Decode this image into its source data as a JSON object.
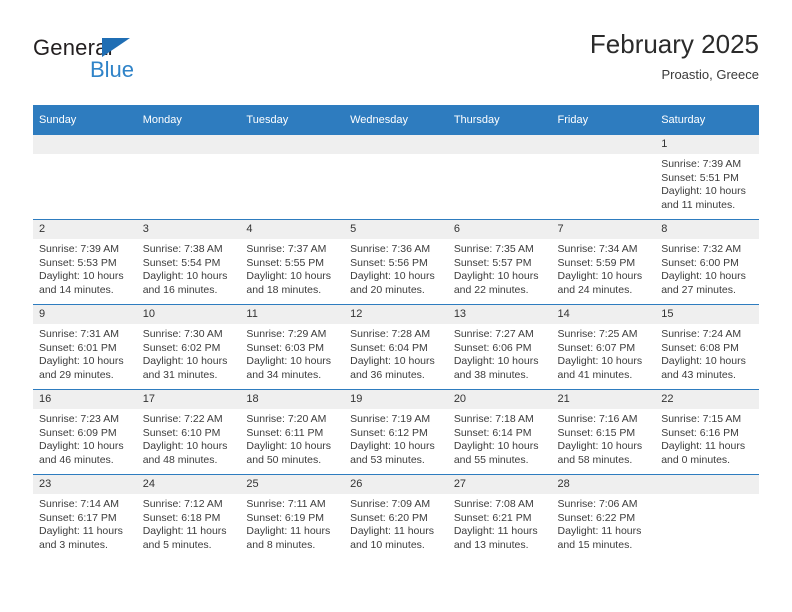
{
  "brand": {
    "name_part1": "General",
    "name_part2": "Blue",
    "triangle_color": "#1f6eb4",
    "text_color": "#231f20",
    "blue_text_color": "#2f83c8"
  },
  "header": {
    "title": "February 2025",
    "subtitle": "Proastio, Greece"
  },
  "theme": {
    "header_blue": "#2e7cbf",
    "daynum_gray": "#efefef",
    "body_text": "#3c3c3c"
  },
  "weekdays": [
    "Sunday",
    "Monday",
    "Tuesday",
    "Wednesday",
    "Thursday",
    "Friday",
    "Saturday"
  ],
  "labels": {
    "sunrise_prefix": "Sunrise:",
    "sunset_prefix": "Sunset:",
    "daylight_prefix": "Daylight:"
  },
  "weeks": [
    [
      {
        "day": "",
        "sunrise": "",
        "sunset": "",
        "daylight_line1": "",
        "daylight_line2": "",
        "empty": true
      },
      {
        "day": "",
        "sunrise": "",
        "sunset": "",
        "daylight_line1": "",
        "daylight_line2": "",
        "empty": true
      },
      {
        "day": "",
        "sunrise": "",
        "sunset": "",
        "daylight_line1": "",
        "daylight_line2": "",
        "empty": true
      },
      {
        "day": "",
        "sunrise": "",
        "sunset": "",
        "daylight_line1": "",
        "daylight_line2": "",
        "empty": true
      },
      {
        "day": "",
        "sunrise": "",
        "sunset": "",
        "daylight_line1": "",
        "daylight_line2": "",
        "empty": true
      },
      {
        "day": "",
        "sunrise": "",
        "sunset": "",
        "daylight_line1": "",
        "daylight_line2": "",
        "empty": true
      },
      {
        "day": "1",
        "sunrise": "Sunrise: 7:39 AM",
        "sunset": "Sunset: 5:51 PM",
        "daylight_line1": "Daylight: 10 hours",
        "daylight_line2": "and 11 minutes.",
        "empty": false
      }
    ],
    [
      {
        "day": "2",
        "sunrise": "Sunrise: 7:39 AM",
        "sunset": "Sunset: 5:53 PM",
        "daylight_line1": "Daylight: 10 hours",
        "daylight_line2": "and 14 minutes.",
        "empty": false
      },
      {
        "day": "3",
        "sunrise": "Sunrise: 7:38 AM",
        "sunset": "Sunset: 5:54 PM",
        "daylight_line1": "Daylight: 10 hours",
        "daylight_line2": "and 16 minutes.",
        "empty": false
      },
      {
        "day": "4",
        "sunrise": "Sunrise: 7:37 AM",
        "sunset": "Sunset: 5:55 PM",
        "daylight_line1": "Daylight: 10 hours",
        "daylight_line2": "and 18 minutes.",
        "empty": false
      },
      {
        "day": "5",
        "sunrise": "Sunrise: 7:36 AM",
        "sunset": "Sunset: 5:56 PM",
        "daylight_line1": "Daylight: 10 hours",
        "daylight_line2": "and 20 minutes.",
        "empty": false
      },
      {
        "day": "6",
        "sunrise": "Sunrise: 7:35 AM",
        "sunset": "Sunset: 5:57 PM",
        "daylight_line1": "Daylight: 10 hours",
        "daylight_line2": "and 22 minutes.",
        "empty": false
      },
      {
        "day": "7",
        "sunrise": "Sunrise: 7:34 AM",
        "sunset": "Sunset: 5:59 PM",
        "daylight_line1": "Daylight: 10 hours",
        "daylight_line2": "and 24 minutes.",
        "empty": false
      },
      {
        "day": "8",
        "sunrise": "Sunrise: 7:32 AM",
        "sunset": "Sunset: 6:00 PM",
        "daylight_line1": "Daylight: 10 hours",
        "daylight_line2": "and 27 minutes.",
        "empty": false
      }
    ],
    [
      {
        "day": "9",
        "sunrise": "Sunrise: 7:31 AM",
        "sunset": "Sunset: 6:01 PM",
        "daylight_line1": "Daylight: 10 hours",
        "daylight_line2": "and 29 minutes.",
        "empty": false
      },
      {
        "day": "10",
        "sunrise": "Sunrise: 7:30 AM",
        "sunset": "Sunset: 6:02 PM",
        "daylight_line1": "Daylight: 10 hours",
        "daylight_line2": "and 31 minutes.",
        "empty": false
      },
      {
        "day": "11",
        "sunrise": "Sunrise: 7:29 AM",
        "sunset": "Sunset: 6:03 PM",
        "daylight_line1": "Daylight: 10 hours",
        "daylight_line2": "and 34 minutes.",
        "empty": false
      },
      {
        "day": "12",
        "sunrise": "Sunrise: 7:28 AM",
        "sunset": "Sunset: 6:04 PM",
        "daylight_line1": "Daylight: 10 hours",
        "daylight_line2": "and 36 minutes.",
        "empty": false
      },
      {
        "day": "13",
        "sunrise": "Sunrise: 7:27 AM",
        "sunset": "Sunset: 6:06 PM",
        "daylight_line1": "Daylight: 10 hours",
        "daylight_line2": "and 38 minutes.",
        "empty": false
      },
      {
        "day": "14",
        "sunrise": "Sunrise: 7:25 AM",
        "sunset": "Sunset: 6:07 PM",
        "daylight_line1": "Daylight: 10 hours",
        "daylight_line2": "and 41 minutes.",
        "empty": false
      },
      {
        "day": "15",
        "sunrise": "Sunrise: 7:24 AM",
        "sunset": "Sunset: 6:08 PM",
        "daylight_line1": "Daylight: 10 hours",
        "daylight_line2": "and 43 minutes.",
        "empty": false
      }
    ],
    [
      {
        "day": "16",
        "sunrise": "Sunrise: 7:23 AM",
        "sunset": "Sunset: 6:09 PM",
        "daylight_line1": "Daylight: 10 hours",
        "daylight_line2": "and 46 minutes.",
        "empty": false
      },
      {
        "day": "17",
        "sunrise": "Sunrise: 7:22 AM",
        "sunset": "Sunset: 6:10 PM",
        "daylight_line1": "Daylight: 10 hours",
        "daylight_line2": "and 48 minutes.",
        "empty": false
      },
      {
        "day": "18",
        "sunrise": "Sunrise: 7:20 AM",
        "sunset": "Sunset: 6:11 PM",
        "daylight_line1": "Daylight: 10 hours",
        "daylight_line2": "and 50 minutes.",
        "empty": false
      },
      {
        "day": "19",
        "sunrise": "Sunrise: 7:19 AM",
        "sunset": "Sunset: 6:12 PM",
        "daylight_line1": "Daylight: 10 hours",
        "daylight_line2": "and 53 minutes.",
        "empty": false
      },
      {
        "day": "20",
        "sunrise": "Sunrise: 7:18 AM",
        "sunset": "Sunset: 6:14 PM",
        "daylight_line1": "Daylight: 10 hours",
        "daylight_line2": "and 55 minutes.",
        "empty": false
      },
      {
        "day": "21",
        "sunrise": "Sunrise: 7:16 AM",
        "sunset": "Sunset: 6:15 PM",
        "daylight_line1": "Daylight: 10 hours",
        "daylight_line2": "and 58 minutes.",
        "empty": false
      },
      {
        "day": "22",
        "sunrise": "Sunrise: 7:15 AM",
        "sunset": "Sunset: 6:16 PM",
        "daylight_line1": "Daylight: 11 hours",
        "daylight_line2": "and 0 minutes.",
        "empty": false
      }
    ],
    [
      {
        "day": "23",
        "sunrise": "Sunrise: 7:14 AM",
        "sunset": "Sunset: 6:17 PM",
        "daylight_line1": "Daylight: 11 hours",
        "daylight_line2": "and 3 minutes.",
        "empty": false
      },
      {
        "day": "24",
        "sunrise": "Sunrise: 7:12 AM",
        "sunset": "Sunset: 6:18 PM",
        "daylight_line1": "Daylight: 11 hours",
        "daylight_line2": "and 5 minutes.",
        "empty": false
      },
      {
        "day": "25",
        "sunrise": "Sunrise: 7:11 AM",
        "sunset": "Sunset: 6:19 PM",
        "daylight_line1": "Daylight: 11 hours",
        "daylight_line2": "and 8 minutes.",
        "empty": false
      },
      {
        "day": "26",
        "sunrise": "Sunrise: 7:09 AM",
        "sunset": "Sunset: 6:20 PM",
        "daylight_line1": "Daylight: 11 hours",
        "daylight_line2": "and 10 minutes.",
        "empty": false
      },
      {
        "day": "27",
        "sunrise": "Sunrise: 7:08 AM",
        "sunset": "Sunset: 6:21 PM",
        "daylight_line1": "Daylight: 11 hours",
        "daylight_line2": "and 13 minutes.",
        "empty": false
      },
      {
        "day": "28",
        "sunrise": "Sunrise: 7:06 AM",
        "sunset": "Sunset: 6:22 PM",
        "daylight_line1": "Daylight: 11 hours",
        "daylight_line2": "and 15 minutes.",
        "empty": false
      },
      {
        "day": "",
        "sunrise": "",
        "sunset": "",
        "daylight_line1": "",
        "daylight_line2": "",
        "empty": true
      }
    ]
  ]
}
